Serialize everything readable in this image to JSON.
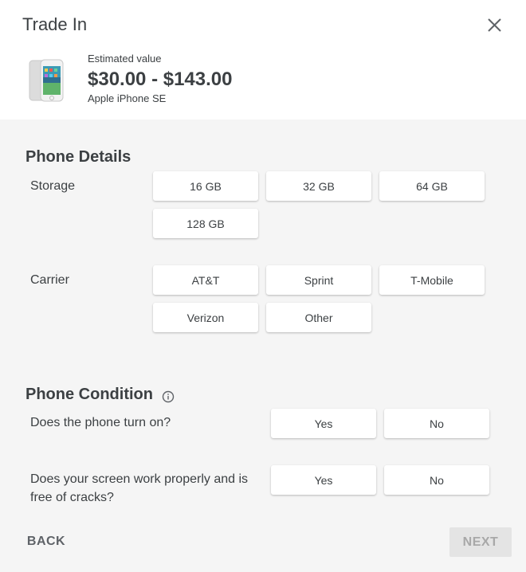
{
  "header": {
    "title": "Trade In",
    "estimated_label": "Estimated value",
    "estimated_value": "$30.00 - $143.00",
    "device_name": "Apple iPhone SE"
  },
  "phone_details": {
    "title": "Phone Details",
    "storage": {
      "label": "Storage",
      "options": [
        "16 GB",
        "32 GB",
        "64 GB",
        "128 GB"
      ]
    },
    "carrier": {
      "label": "Carrier",
      "options": [
        "AT&T",
        "Sprint",
        "T-Mobile",
        "Verizon",
        "Other"
      ]
    }
  },
  "phone_condition": {
    "title": "Phone Condition",
    "questions": [
      {
        "text": "Does the phone turn on?",
        "yes": "Yes",
        "no": "No"
      },
      {
        "text": "Does your screen work properly and is free of cracks?",
        "yes": "Yes",
        "no": "No"
      }
    ]
  },
  "footer": {
    "back_label": "BACK",
    "next_label": "NEXT"
  }
}
